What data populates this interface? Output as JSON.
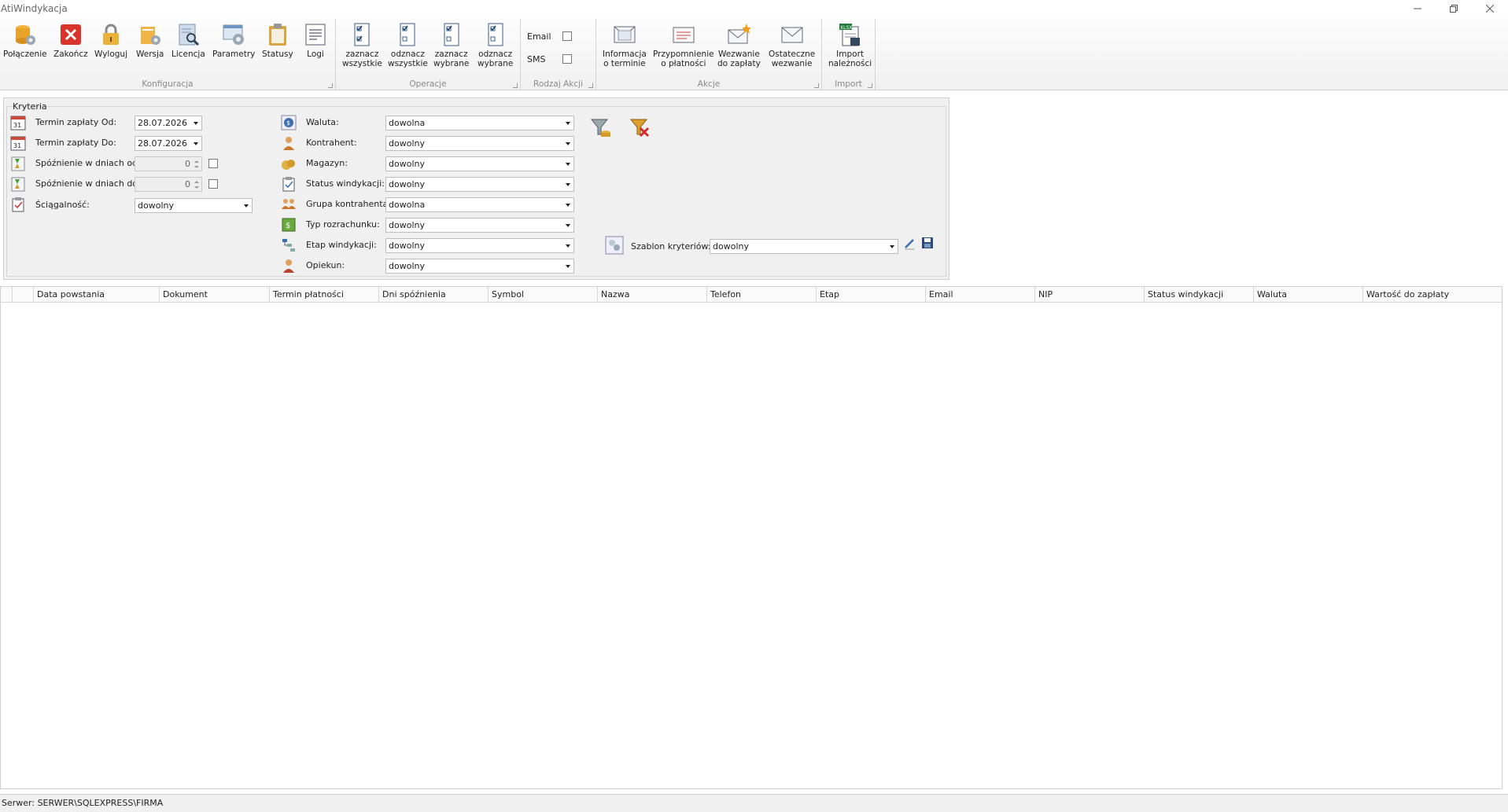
{
  "window": {
    "title": "AtiWindykacja",
    "controls": [
      "minimize-icon",
      "restore-icon",
      "close-icon"
    ]
  },
  "ribbon": {
    "groups": {
      "konfiguracja": {
        "label": "Konfiguracja",
        "buttons": [
          {
            "label": "Połączenie",
            "icon": "database-gear-icon"
          },
          {
            "label": "Zakończ",
            "icon": "red-x-icon"
          },
          {
            "label": "Wyloguj",
            "icon": "padlock-icon"
          },
          {
            "label": "Wersja",
            "icon": "version-gear-icon"
          },
          {
            "label": "Licencja",
            "icon": "license-magnifier-icon"
          },
          {
            "label": "Parametry",
            "icon": "parameters-gear-icon"
          },
          {
            "label": "Statusy",
            "icon": "clipboard-icon"
          },
          {
            "label": "Logi",
            "icon": "document-lines-icon"
          }
        ]
      },
      "operacje": {
        "label": "Operacje",
        "buttons": [
          {
            "label": "zaznacz\nwszystkie",
            "icon": "select-all-icon"
          },
          {
            "label": "odznacz\nwszystkie",
            "icon": "deselect-all-icon"
          },
          {
            "label": "zaznacz\nwybrane",
            "icon": "select-chosen-icon"
          },
          {
            "label": "odznacz\nwybrane",
            "icon": "deselect-chosen-icon"
          }
        ]
      },
      "rodzaj": {
        "label": "Rodzaj Akcji",
        "email": "Email",
        "sms": "SMS"
      },
      "akcje": {
        "label": "Akcje",
        "buttons": [
          {
            "label": "Informacja\no terminie",
            "icon": "info-letter-icon"
          },
          {
            "label": "Przypomnienie\no płatności",
            "icon": "reminder-envelope-icon"
          },
          {
            "label": "Wezwanie\ndo zapłaty",
            "icon": "summons-envelope-icon"
          },
          {
            "label": "Ostateczne\nwezwanie",
            "icon": "final-envelope-icon"
          }
        ]
      },
      "import": {
        "label": "Import",
        "buttons": [
          {
            "label": "Import\nnależności",
            "icon": "xlsx-import-icon"
          }
        ]
      }
    }
  },
  "criteria": {
    "legend": "Kryteria",
    "left": {
      "termin_od": {
        "label": "Termin zapłaty Od:",
        "value": "28.07.2026"
      },
      "termin_do": {
        "label": "Termin zapłaty  Do:",
        "value": "28.07.2026"
      },
      "spoz_od": {
        "label": "Spóźnienie w dniach od:",
        "value": "0"
      },
      "spoz_do": {
        "label": "Spóźnienie w dniach do:",
        "value": "0"
      },
      "sciagalnosc": {
        "label": "Ściągalność:",
        "value": "dowolny"
      }
    },
    "middle": [
      {
        "label": "Waluta:",
        "value": "dowolna"
      },
      {
        "label": "Kontrahent:",
        "value": "dowolny"
      },
      {
        "label": "Magazyn:",
        "value": "dowolny"
      },
      {
        "label": "Status windykacji:",
        "value": "dowolny"
      },
      {
        "label": "Grupa kontrahenta:",
        "value": "dowolna"
      },
      {
        "label": "Typ rozrachunku:",
        "value": "dowolny"
      },
      {
        "label": "Etap windykacji:",
        "value": "dowolny"
      },
      {
        "label": "Opiekun:",
        "value": "dowolny"
      }
    ],
    "szablon": {
      "label": "Szablon kryteriów:",
      "value": "dowolny"
    }
  },
  "grid": {
    "columns": [
      "",
      "Data powstania",
      "Dokument",
      "Termin płatności",
      "Dni spóźnienia",
      "Symbol",
      "Nazwa",
      "Telefon",
      "Etap",
      "Email",
      "NIP",
      "Status windykacji",
      "Waluta",
      "Wartość do zapłaty"
    ]
  },
  "status": {
    "server": "Serwer: SERWER\\SQLEXPRESS\\FIRMA"
  }
}
